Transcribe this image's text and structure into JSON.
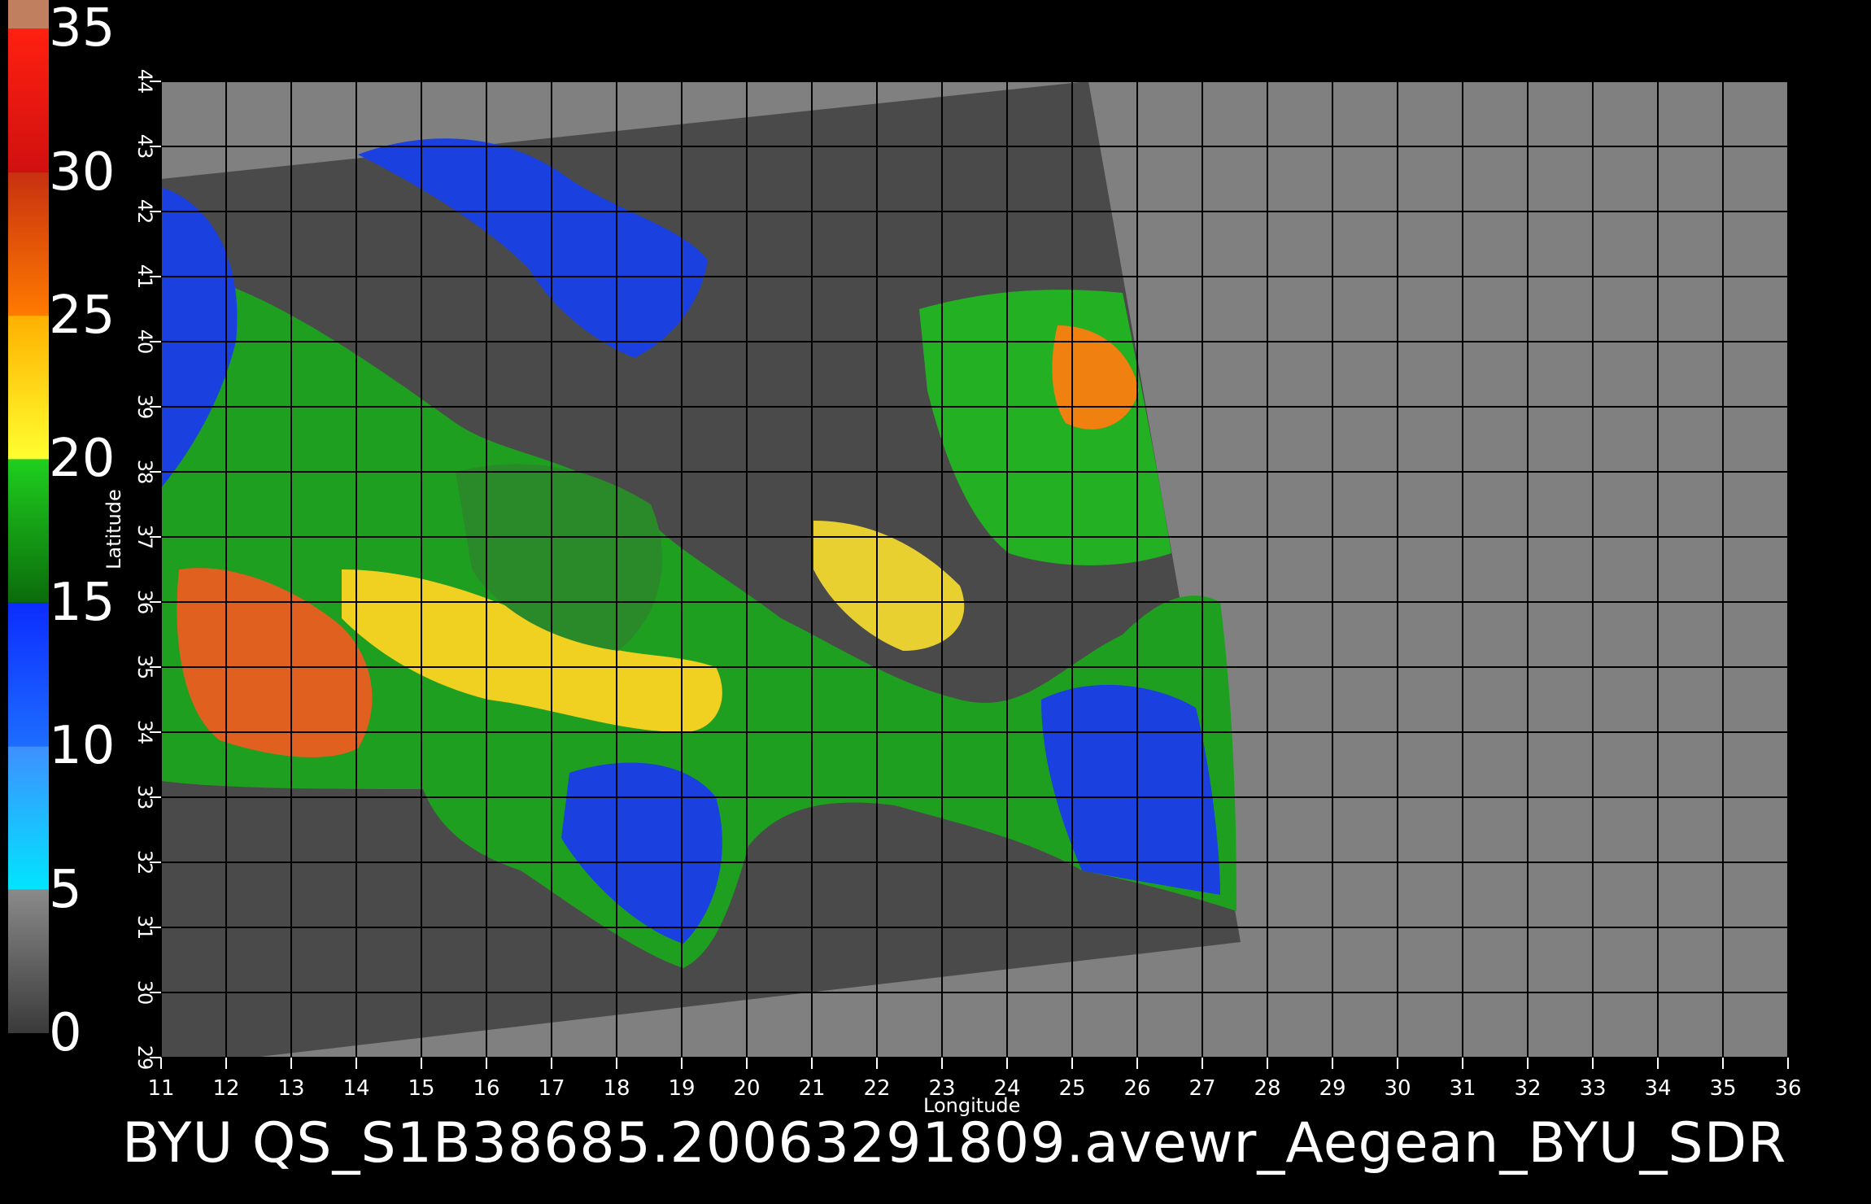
{
  "caption": "BYU  QS_S1B38685.20063291809.avewr_Aegean_BYU_SDR",
  "colorbar": {
    "labels": [
      "35",
      "30",
      "25",
      "20",
      "15",
      "10",
      "5",
      "0"
    ],
    "stops": [
      {
        "from": 0,
        "to": 5,
        "color_top": "#8a8a8a",
        "color_bottom": "#3a3a3a"
      },
      {
        "from": 5,
        "to": 10,
        "color_top": "#3f8fff",
        "color_bottom": "#00e5ff"
      },
      {
        "from": 10,
        "to": 15,
        "color_top": "#0c2cff",
        "color_bottom": "#1e6dff"
      },
      {
        "from": 15,
        "to": 20,
        "color_top": "#1fcf1f",
        "color_bottom": "#0b6b0b"
      },
      {
        "from": 20,
        "to": 25,
        "color_top": "#ffb000",
        "color_bottom": "#ffff30"
      },
      {
        "from": 25,
        "to": 30,
        "color_top": "#c83010",
        "color_bottom": "#ff7a00"
      },
      {
        "from": 30,
        "to": 35,
        "color_top": "#ff2010",
        "color_bottom": "#d01010"
      },
      {
        "from": 35,
        "to": 36,
        "color_top": "#c08060",
        "color_bottom": "#c08060"
      }
    ]
  },
  "map": {
    "xlabel": "Longitude",
    "ylabel": "Latitude",
    "lon_range": [
      11,
      36
    ],
    "lat_range": [
      29,
      44
    ],
    "lon_ticks": [
      "11",
      "12",
      "13",
      "14",
      "15",
      "16",
      "17",
      "18",
      "19",
      "20",
      "21",
      "22",
      "23",
      "24",
      "25",
      "26",
      "27",
      "28",
      "29",
      "30",
      "31",
      "32",
      "33",
      "34",
      "35",
      "36"
    ],
    "lat_ticks": [
      "29",
      "30",
      "31",
      "32",
      "33",
      "34",
      "35",
      "36",
      "37",
      "38",
      "39",
      "40",
      "41",
      "42",
      "43",
      "44"
    ],
    "background_color": "#808080",
    "swath_color": "#4a4a4a",
    "grid_color": "#000000"
  }
}
